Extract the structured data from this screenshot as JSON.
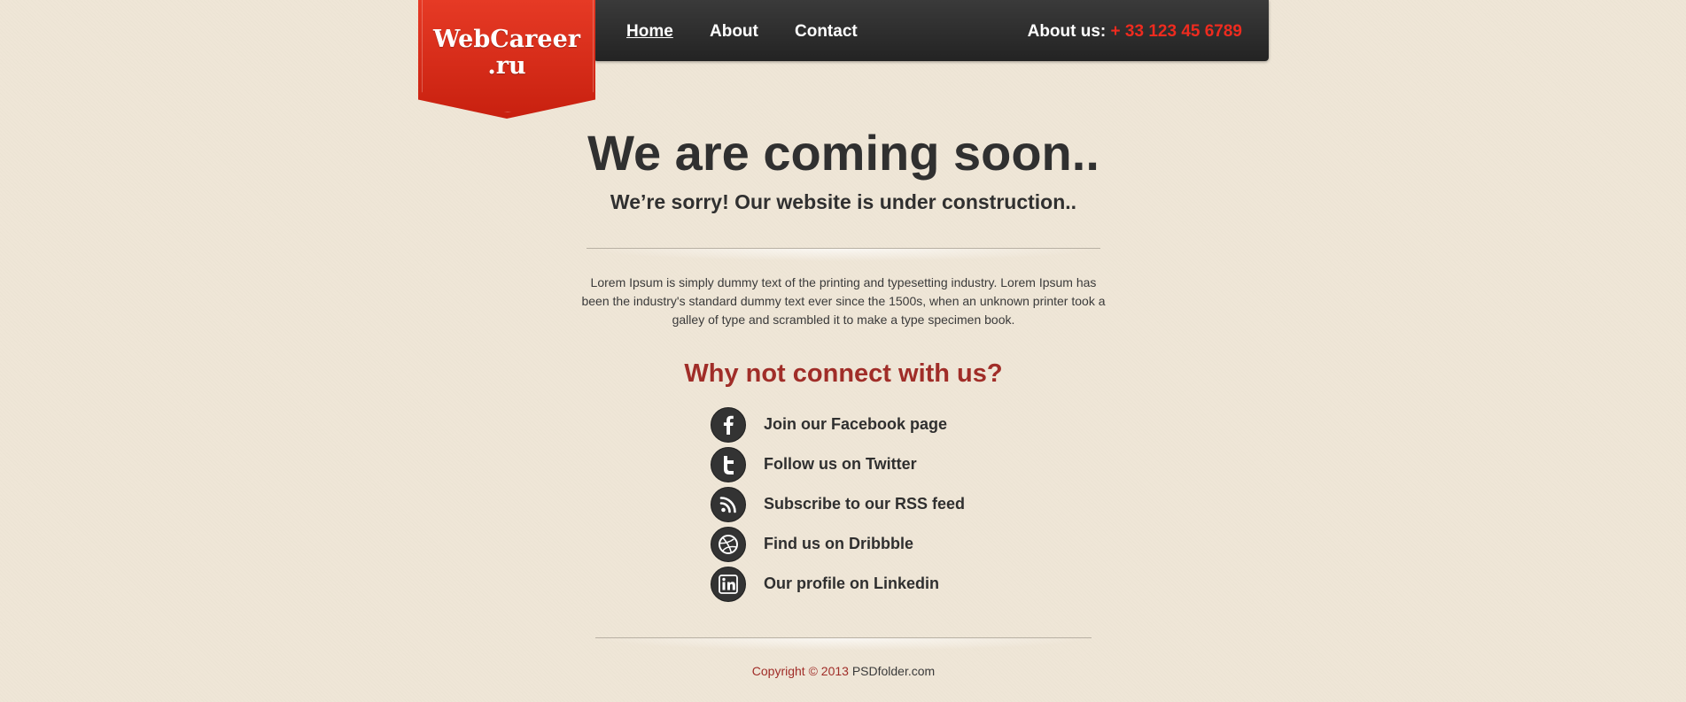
{
  "logo": {
    "line1": "WebCareer",
    "line2": ".ru"
  },
  "nav": {
    "items": [
      {
        "label": "Home",
        "active": true
      },
      {
        "label": "About",
        "active": false
      },
      {
        "label": "Contact",
        "active": false
      }
    ],
    "contact_label": "About us:",
    "phone": "+ 33 123 45 6789"
  },
  "main": {
    "headline": "We are coming soon..",
    "subheadline": "We’re sorry! Our website is under construction..",
    "intro": "Lorem Ipsum is simply dummy text of the printing and typesetting industry. Lorem Ipsum has been the industry's standard dummy text ever since the 1500s, when an unknown printer took a galley of type and scrambled it to make a type specimen book.",
    "connect_title": "Why not connect with us?"
  },
  "social": [
    {
      "label": "Join our Facebook page",
      "icon": "facebook-icon"
    },
    {
      "label": "Follow us on Twitter",
      "icon": "twitter-icon"
    },
    {
      "label": "Subscribe to our RSS feed",
      "icon": "rss-icon"
    },
    {
      "label": "Find us on Dribbble",
      "icon": "dribbble-icon"
    },
    {
      "label": "Our profile on Linkedin",
      "icon": "linkedin-icon"
    }
  ],
  "footer": {
    "copyright": "Copyright © 2013",
    "site": "PSDfolder.com"
  },
  "colors": {
    "background": "#efe6d7",
    "navbar": "#2a2a2a",
    "logo_red": "#d92b17",
    "accent_red": "#a02d28",
    "phone_red": "#ee2b1f",
    "text_dark": "#2f2f2f"
  }
}
